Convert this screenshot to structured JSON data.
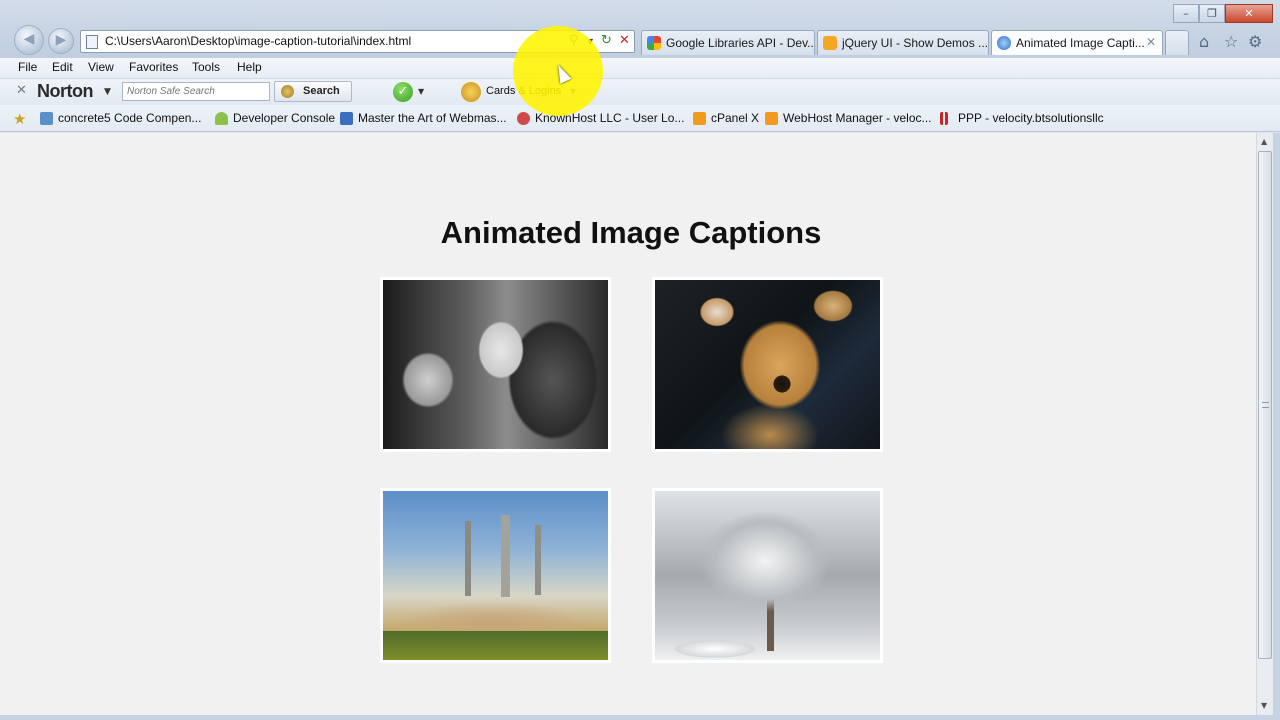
{
  "address_bar": {
    "url": "C:\\Users\\Aaron\\Desktop\\image-caption-tutorial\\index.html"
  },
  "tabs": [
    {
      "label": "Google Libraries API - Dev...",
      "icon": "google-icon",
      "color": "#4a8af4"
    },
    {
      "label": "jQuery UI - Show Demos ...",
      "icon": "jquery-ui-icon",
      "color": "#f5a623"
    },
    {
      "label": "Animated Image Capti...",
      "icon": "ie-page-icon",
      "color": "#3b7dd8",
      "active": true
    }
  ],
  "menu": {
    "file": "File",
    "edit": "Edit",
    "view": "View",
    "favorites": "Favorites",
    "tools": "Tools",
    "help": "Help"
  },
  "norton_toolbar": {
    "brand": "Norton",
    "search_placeholder": "Norton Safe Search",
    "search_label": "Search",
    "cards_label": "Cards & Logins"
  },
  "favorites": [
    {
      "label": "concrete5  Code Compen...",
      "icon": "page-icon",
      "color": "#5b8fc8"
    },
    {
      "label": "Developer Console",
      "icon": "android-icon",
      "color": "#8bc34a"
    },
    {
      "label": "Master the Art of Webmas...",
      "icon": "hp-icon",
      "color": "#3a6fbf"
    },
    {
      "label": "KnownHost LLC - User Lo...",
      "icon": "knownhost-icon",
      "color": "#d04a4a"
    },
    {
      "label": "cPanel X",
      "icon": "cpanel-icon",
      "color": "#f29a1e"
    },
    {
      "label": "WebHost Manager - veloc...",
      "icon": "cpanel-icon",
      "color": "#f29a1e"
    },
    {
      "label": "PPP - velocity.btsolutionsllc",
      "icon": "ppp-icon",
      "color": "#c62828"
    }
  ],
  "page": {
    "title": "Animated Image Captions",
    "photos": [
      {
        "name": "photo-woman-dog"
      },
      {
        "name": "photo-tan-dog"
      },
      {
        "name": "photo-smokestacks"
      },
      {
        "name": "photo-snowy-tree"
      }
    ]
  },
  "colors": {
    "cursor_highlight": "#fff200",
    "page_background": "#f1f1f1"
  }
}
